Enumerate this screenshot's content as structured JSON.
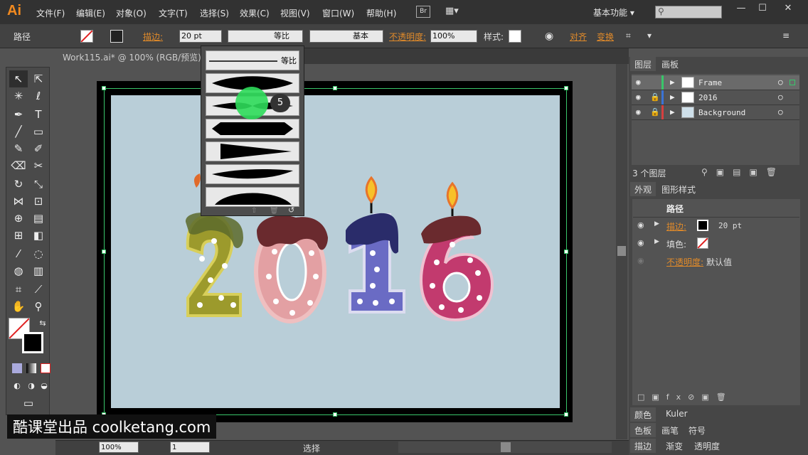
{
  "app": {
    "logo": "Ai",
    "menus": [
      "文件(F)",
      "编辑(E)",
      "对象(O)",
      "文字(T)",
      "选择(S)",
      "效果(C)",
      "视图(V)",
      "窗口(W)",
      "帮助(H)"
    ],
    "bridge": "Br",
    "workspace": "基本功能 ▾",
    "search_placeholder": "⚲",
    "win_min": "—",
    "win_max": "☐",
    "win_close": "✕"
  },
  "control": {
    "object": "路径",
    "stroke_label": "描边:",
    "stroke_weight": "20 pt",
    "profile": "等比",
    "brush": "基本",
    "opacity_label": "不透明度:",
    "opacity": "100%",
    "style_label": "样式:",
    "align": "对齐",
    "transform": "变换"
  },
  "document": {
    "tab": "Work115.ai* @ 100% (RGB/预览)"
  },
  "artwork": {
    "year": "2016",
    "digit_colors": [
      "#9c9a2c",
      "#e3a0a3",
      "#6a6bc4",
      "#c23a6e"
    ]
  },
  "profile_popup": {
    "first_label": "等比",
    "tooltip_number": "5",
    "count": 7
  },
  "layers_panel": {
    "tab_layers": "图层",
    "tab_artboards": "画板",
    "layers": [
      {
        "name": "Frame",
        "color": "#39c66a"
      },
      {
        "name": "2016",
        "color": "#3a74d6"
      },
      {
        "name": "Background",
        "color": "#d64040"
      }
    ],
    "count": "3 个图层"
  },
  "appearance_panel": {
    "tab": "外观",
    "tab2": "图形样式",
    "title": "路径",
    "stroke_label": "描边:",
    "stroke_value": "20 pt",
    "fill_label": "填色:",
    "opacity_label": "不透明度:",
    "opacity_value": "默认值"
  },
  "bottom_panels": {
    "color": "颜色",
    "kuler": "Kuler",
    "swatches": "色板",
    "brushes": "画笔",
    "symbols": "符号",
    "stroke": "描边",
    "gradient": "渐变",
    "transparency": "透明度"
  },
  "status": {
    "zoom": "100%",
    "page": "1",
    "tool": "选择"
  },
  "watermark": "酷课堂出品 coolketang.com"
}
